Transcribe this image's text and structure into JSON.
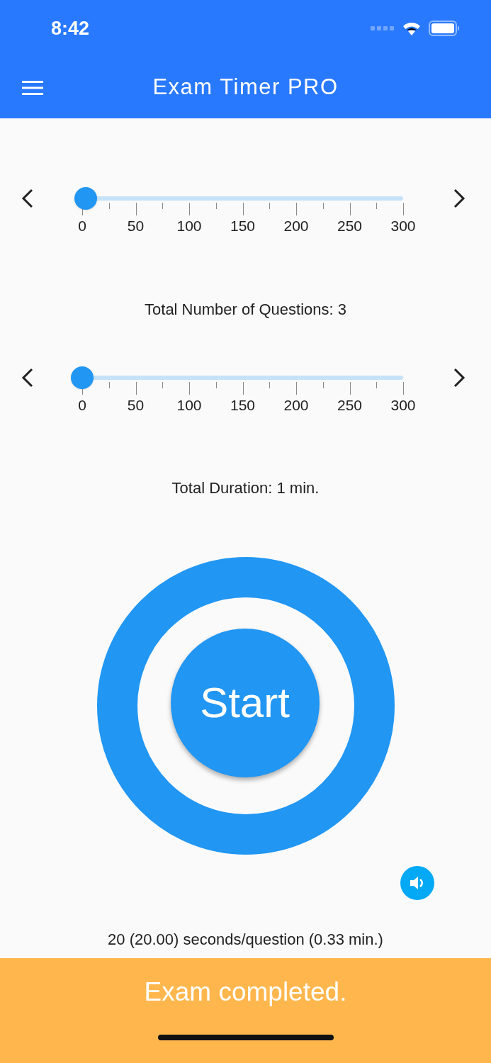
{
  "status_bar": {
    "time": "8:42"
  },
  "app_bar": {
    "title": "Exam Timer PRO"
  },
  "sliders": [
    {
      "level": 0.01,
      "ticks": [
        "0",
        "50",
        "100",
        "150",
        "200",
        "250",
        "300"
      ],
      "caption": "Total Number of Questions: 3"
    },
    {
      "level": 0,
      "ticks": [
        "0",
        "50",
        "100",
        "150",
        "200",
        "250",
        "300"
      ],
      "caption": "Total Duration: 1 min."
    }
  ],
  "timer": {
    "level": 1,
    "button": "Start"
  },
  "per_question": "20 (20.00) seconds/question (0.33 min.)",
  "banner": "Exam completed."
}
